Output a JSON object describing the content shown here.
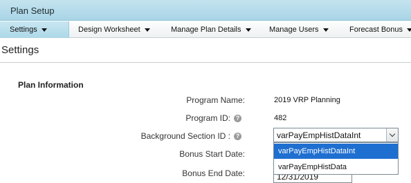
{
  "app": {
    "title": "Plan Setup"
  },
  "menu": [
    {
      "label": "Settings"
    },
    {
      "label": "Design Worksheet"
    },
    {
      "label": "Manage Plan Details"
    },
    {
      "label": "Manage Users"
    },
    {
      "label": "Forecast Bonus"
    }
  ],
  "page": {
    "heading": "Settings"
  },
  "plan_info": {
    "section_title": "Plan Information",
    "program_name_label": "Program Name:",
    "program_name_value": "2019 VRP Planning",
    "program_id_label": "Program ID:",
    "program_id_value": "482",
    "bg_section_label": "Background Section ID :",
    "bg_section_selected": "varPayEmpHistDataInt",
    "bg_section_options": [
      "varPayEmpHistDataInt",
      "varPayEmpHistData"
    ],
    "bonus_start_label": "Bonus Start Date:",
    "bonus_end_label": "Bonus End Date:",
    "bonus_end_value": "12/31/2019"
  },
  "icons": {
    "help": "help-icon",
    "dropdown": "chevron-down-icon",
    "menu_caret": "caret-down-icon"
  },
  "colors": {
    "titlebar": "#a9d5e6",
    "selection": "#1f6fd1"
  }
}
